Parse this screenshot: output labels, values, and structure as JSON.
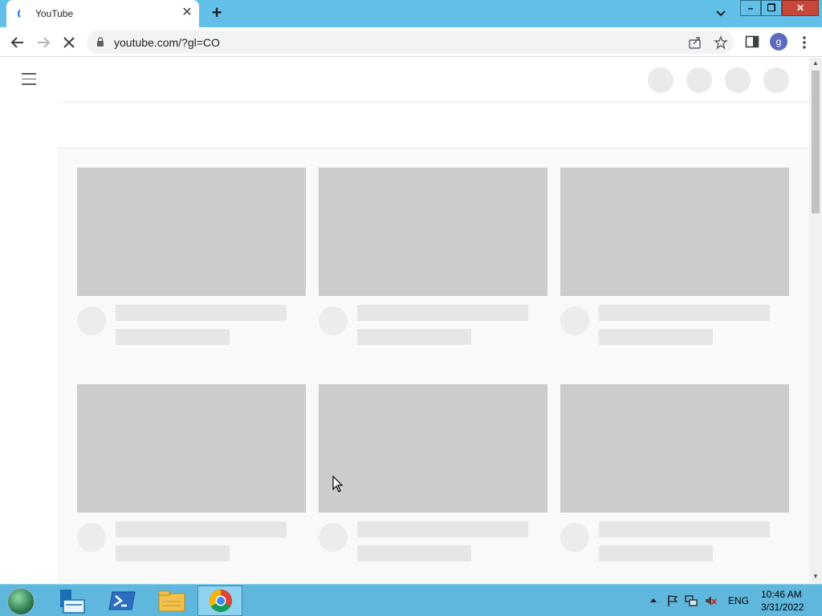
{
  "browser": {
    "tab": {
      "title": "YouTube",
      "close_symbol": "✕"
    },
    "new_tab_symbol": "+",
    "address": {
      "url": "youtube.com/?gl=CO"
    },
    "profile_initial": "g",
    "window_controls": {
      "minimize": "–",
      "maximize": "❐",
      "close": "✕"
    }
  },
  "page": {
    "loading": true,
    "placeholder_rows": 2,
    "placeholder_columns": 3
  },
  "taskbar": {
    "apps": [
      "start",
      "server-manager",
      "powershell",
      "file-explorer",
      "chrome"
    ],
    "active_app": "chrome",
    "tray": {
      "language": "ENG"
    },
    "clock": {
      "time": "10:46 AM",
      "date": "3/31/2022"
    }
  },
  "colors": {
    "titlebar": "#62c0e8",
    "taskbar": "#5fb7de",
    "placeholder_thumb": "#cccccc",
    "placeholder_text": "#e6e6e6",
    "content_bg": "#f9f9f9"
  }
}
